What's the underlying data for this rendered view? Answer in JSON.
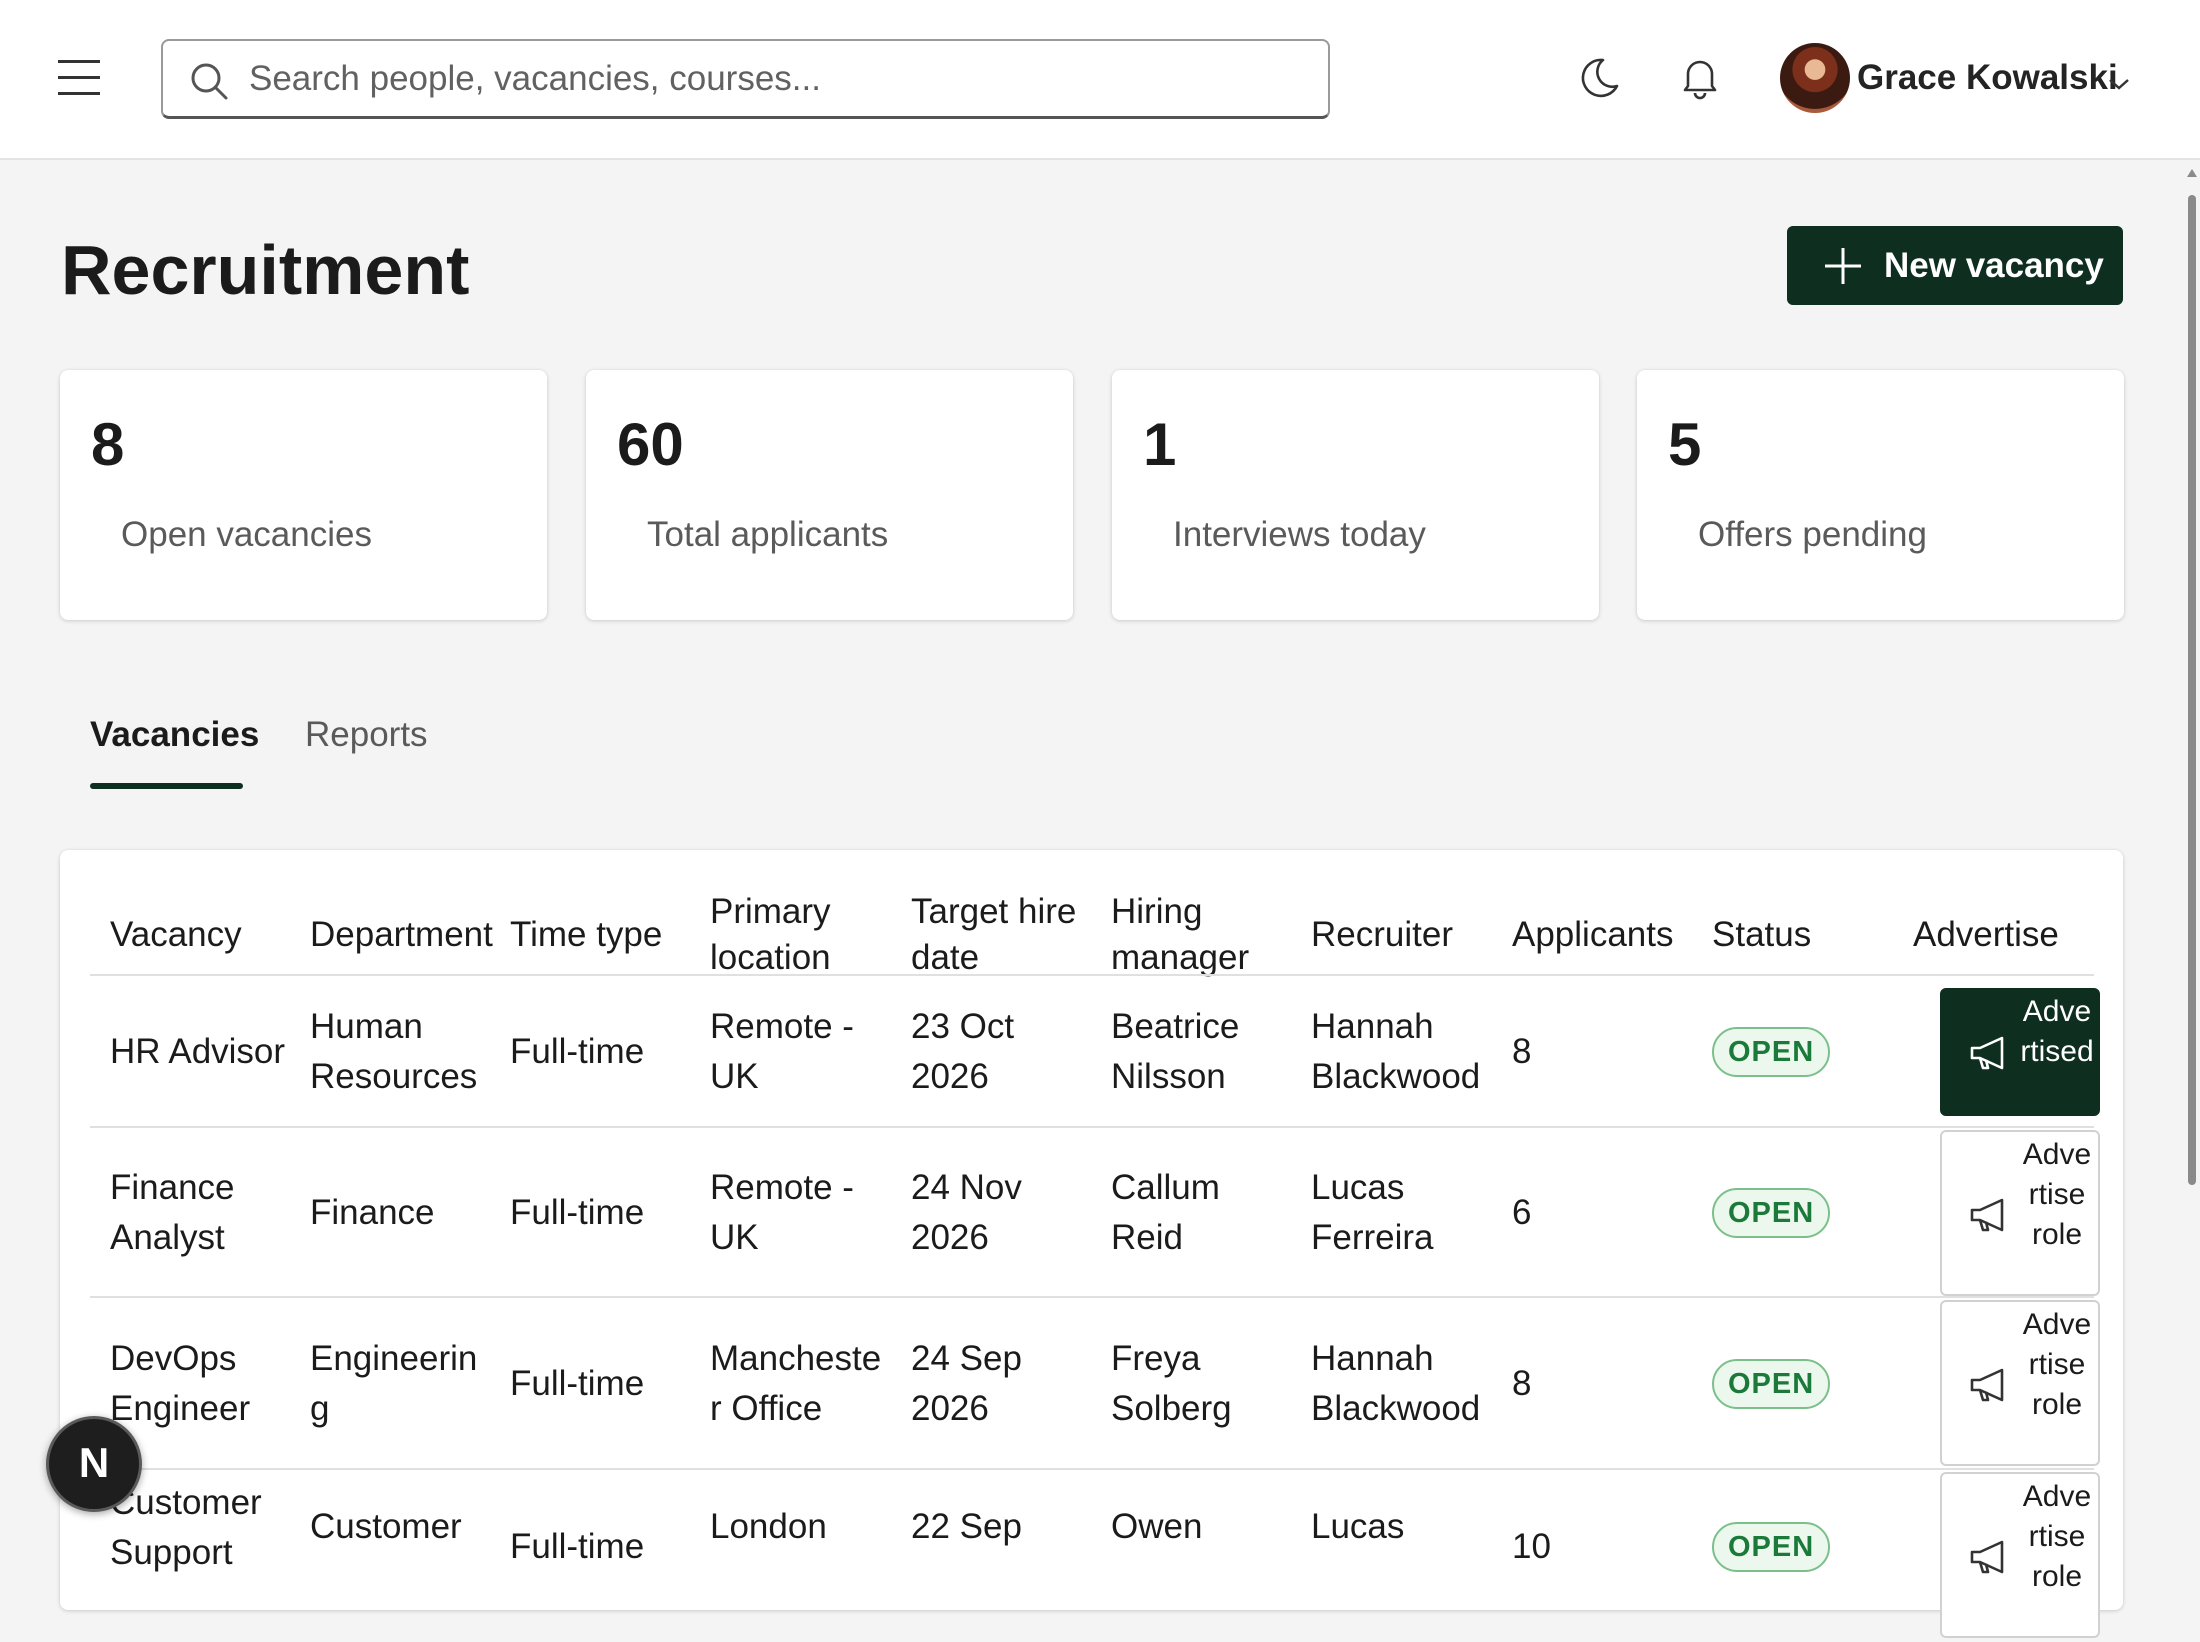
{
  "header": {
    "search_placeholder": "Search people, vacancies, courses...",
    "user_name": "Grace Kowalski"
  },
  "page": {
    "title": "Recruitment",
    "new_button_label": "New vacancy"
  },
  "stats": [
    {
      "value": "8",
      "label": "Open vacancies"
    },
    {
      "value": "60",
      "label": "Total applicants"
    },
    {
      "value": "1",
      "label": "Interviews today"
    },
    {
      "value": "5",
      "label": "Offers pending"
    }
  ],
  "tabs": [
    {
      "label": "Vacancies",
      "active": true
    },
    {
      "label": "Reports",
      "active": false
    }
  ],
  "table": {
    "columns": [
      "Vacancy",
      "Department",
      "Time type",
      "Primary location",
      "Target hire date",
      "Hiring manager",
      "Recruiter",
      "Applicants",
      "Status",
      "Advertise"
    ],
    "rows": [
      {
        "vacancy": "HR Advisor",
        "department": "Human Resources",
        "time_type": "Full-time",
        "location": "Remote - UK",
        "target_date": "23 Oct 2026",
        "hiring_manager": "Beatrice Nilsson",
        "recruiter": "Hannah Blackwood",
        "applicants": "8",
        "status": "OPEN",
        "advertise_label": "Advertised"
      },
      {
        "vacancy": "Finance Analyst",
        "department": "Finance",
        "time_type": "Full-time",
        "location": "Remote - UK",
        "target_date": "24 Nov 2026",
        "hiring_manager": "Callum Reid",
        "recruiter": "Lucas Ferreira",
        "applicants": "6",
        "status": "OPEN",
        "advertise_label": "Advertise role"
      },
      {
        "vacancy": "DevOps Engineer",
        "department": "Engineering",
        "time_type": "Full-time",
        "location": "Manchester Office",
        "target_date": "24 Sep 2026",
        "hiring_manager": "Freya Solberg",
        "recruiter": "Hannah Blackwood",
        "applicants": "8",
        "status": "OPEN",
        "advertise_label": "Advertise role"
      },
      {
        "vacancy": "Customer Support",
        "department": "Customer",
        "time_type": "Full-time",
        "location": "London",
        "target_date": "22 Sep",
        "hiring_manager": "Owen",
        "recruiter": "Lucas",
        "applicants": "10",
        "status": "OPEN",
        "advertise_label": "Advertise role"
      }
    ]
  },
  "fab": {
    "label": "N"
  },
  "colors": {
    "accent": "#0e2e1f",
    "status_green": "#1b7a3a",
    "status_bg": "#ecf8ee"
  }
}
